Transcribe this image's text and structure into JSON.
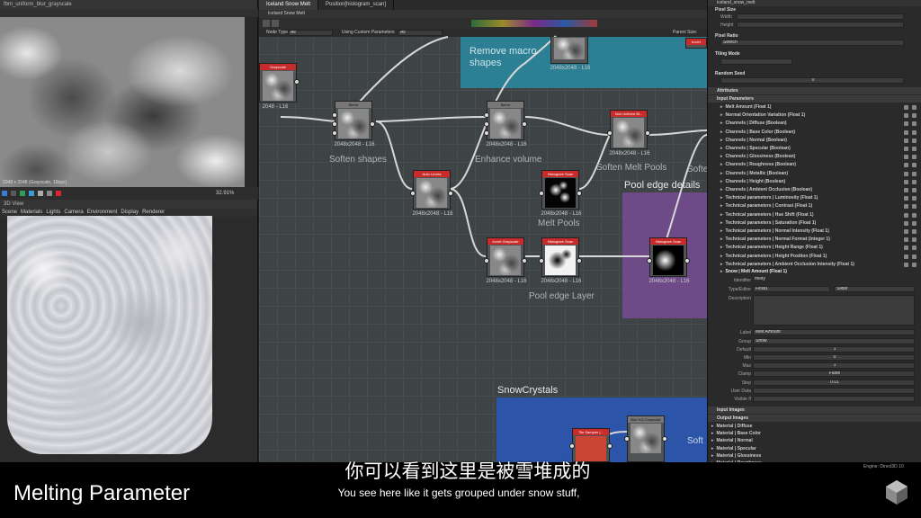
{
  "view2d": {
    "title": "fbm_uniform_blur_grayscale",
    "caption": "2048 x 2048 (Grayscale, 16bpc)",
    "zoom": "32.91%"
  },
  "view3d": {
    "title": "3D View",
    "menu": [
      "Scene",
      "Materials",
      "Lights",
      "Camera",
      "Environment",
      "Display",
      "Renderer"
    ]
  },
  "graph": {
    "tabs": [
      "Iceland Snow Melt",
      "Position[histogram_scan]"
    ],
    "subtitle": "Iceland Snow Melt",
    "toolbar": {
      "node_type_label": "Node Type",
      "node_type_value": "All",
      "params_label": "Using Custom Parameters",
      "params_value": "All",
      "parent_size": "Parent Size:"
    },
    "frames": {
      "top_label": "Remove macro shapes",
      "pool_label": "Pool edge details",
      "snow_label": "SnowCrystals"
    },
    "comments": {
      "soften": "Soften shapes",
      "enhance": "Enhance volume",
      "soften_melt": "Soften Melt Pools",
      "melt_pools": "Melt Pools",
      "pool_edge": "Pool edge Layer",
      "softe_cut": "Softe",
      "softe_cut2": "Soft"
    },
    "nodes": [
      {
        "title": "Grayscale",
        "res": "2048 - L16",
        "red": true
      },
      {
        "title": "Blend",
        "res": "2048x2048 - L16",
        "red": false
      },
      {
        "title": "Blend",
        "res": "2048x2048 - L16",
        "red": false
      },
      {
        "title": "Non Uniform Bl...",
        "res": "2048x2048 - L16",
        "red": true
      },
      {
        "title": "Auto Levels",
        "res": "2048x2048 - L16",
        "red": true
      },
      {
        "title": "Histogram Scan",
        "res": "2048x2048 - L16",
        "red": true
      },
      {
        "title": "Invert Grayscale",
        "res": "2048x2048 - L16",
        "red": true
      },
      {
        "title": "Histogram Scan",
        "res": "2048x2048 - L16",
        "red": true
      },
      {
        "title": "Histogram Scan",
        "res": "2048x2048 - L16",
        "red": true
      },
      {
        "title": "Tile Sampler (...",
        "res": "",
        "red": true
      },
      {
        "title": "Blur HQ Grayscale",
        "res": "",
        "red": false
      },
      {
        "title": "",
        "res": "2048x2048 - L16",
        "red": false
      }
    ],
    "top_node_res": "2048x2048 - L16",
    "invert_label": "Invert"
  },
  "panel": {
    "title": "iceland_snow_melt",
    "pixel_size": "Pixel Size",
    "width_label": "Width",
    "height_label": "Height",
    "pixel_ratio": "Pixel Ratio",
    "pixel_ratio_value": "Stretch",
    "tiling_mode": "Tiling Mode",
    "random_seed": "Random Seed",
    "random_seed_value": "0",
    "attributes": "Attributes",
    "input_parameters": "Input Parameters",
    "params": [
      "Melt Amount (Float 1)",
      "Normal Orientation Variation (Float 1)",
      "Channels | Diffuse (Boolean)",
      "Channels | Base Color (Boolean)",
      "Channels | Normal (Boolean)",
      "Channels | Specular (Boolean)",
      "Channels | Glossiness (Boolean)",
      "Channels | Roughness (Boolean)",
      "Channels | Metallic (Boolean)",
      "Channels | Height (Boolean)",
      "Channels | Ambient Occlusion (Boolean)",
      "Technical parameters | Luminosity (Float 1)",
      "Technical parameters | Contrast (Float 1)",
      "Technical parameters | Hue Shift (Float 1)",
      "Technical parameters | Saturation (Float 1)",
      "Technical parameters | Normal Intensity (Float 1)",
      "Technical parameters | Normal Format (Integer 1)",
      "Technical parameters | Height Range (Float 1)",
      "Technical parameters | Height Position (Float 1)",
      "Technical parameters | Ambient Occlusion Intensity (Float 1)"
    ],
    "expanded": "Snow | Melt Amount (Float 1)",
    "identifier_label": "Identifier",
    "identifier_value": "melty",
    "type_label": "Type/Editor",
    "type_value": "Float1",
    "editor_value": "Slider",
    "description_label": "Description",
    "label_label": "Label",
    "label_value": "Melt Amount",
    "group_label": "Group",
    "group_value": "Snow",
    "default_label": "Default",
    "default_value": "1",
    "min_label": "Min",
    "min_value": "0",
    "max_label": "Max",
    "max_value": "1",
    "clamp_label": "Clamp",
    "clamp_value": "False",
    "step_label": "Step",
    "step_value": "0.01",
    "userdata_label": "User Data",
    "visible_label": "Visible If",
    "input_images": "Input Images",
    "output_images": "Output Images",
    "outputs": [
      "Material | Diffuse",
      "Material | Base Color",
      "Material | Normal",
      "Material | Specular",
      "Material | Glossiness",
      "Material | Roughness"
    ]
  },
  "engine": "Engine: Direct3D 10",
  "subtitle_cn": "你可以看到这里是被雪堆成的",
  "subtitle_en": "You see here like it gets grouped under snow stuff,",
  "lower_third": "Melting Parameter"
}
